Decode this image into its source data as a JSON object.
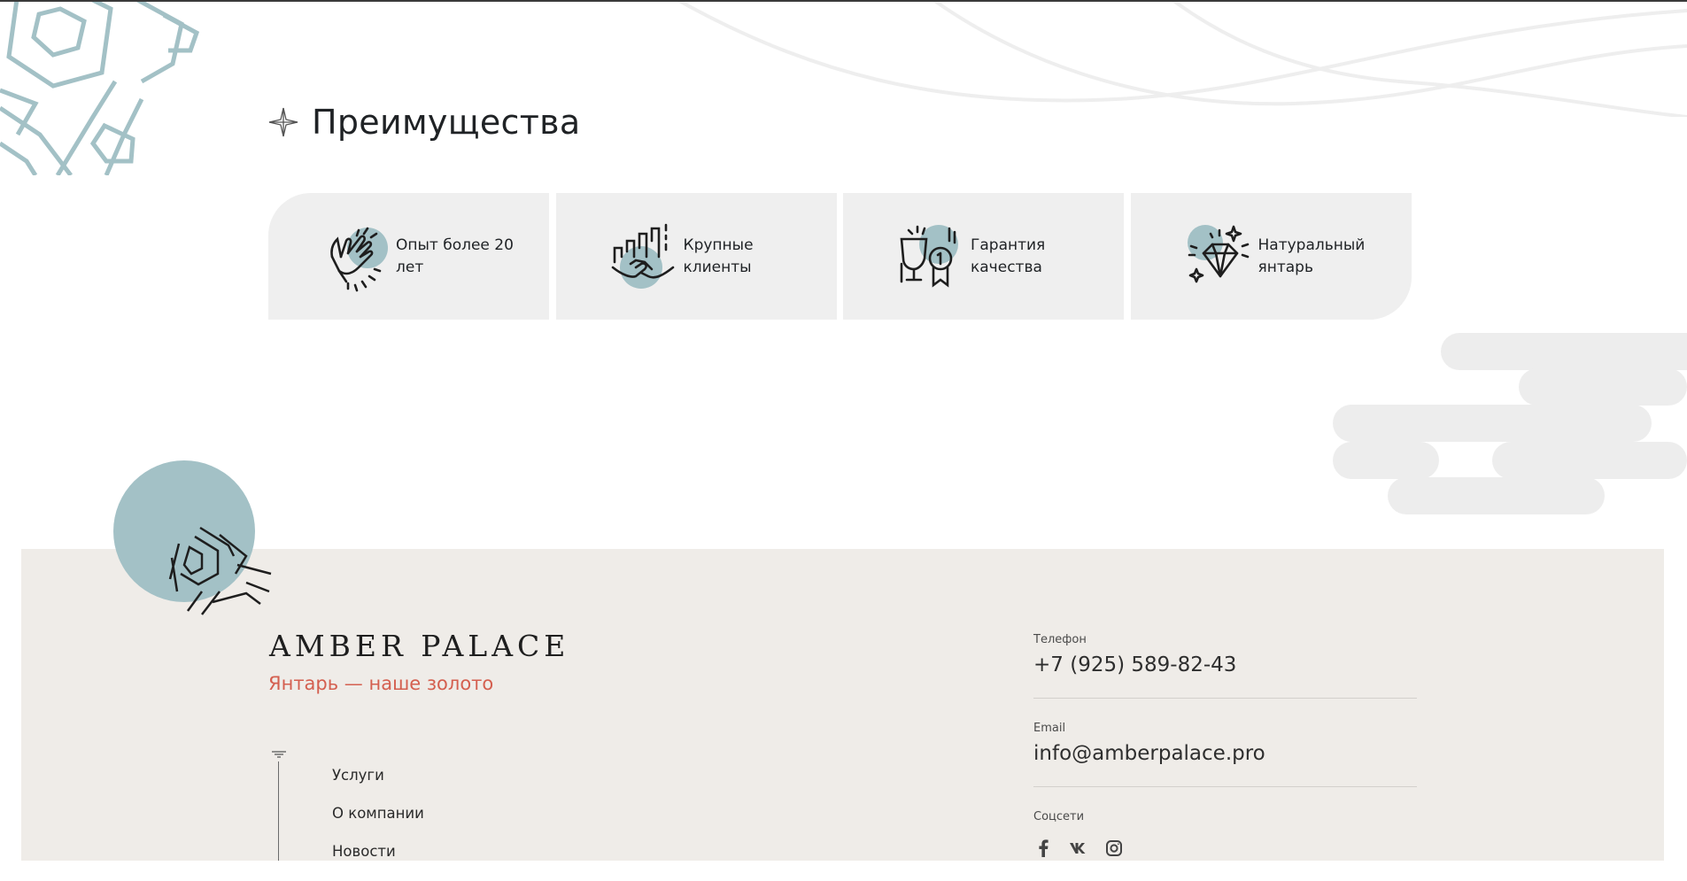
{
  "section": {
    "title": "Преимущества"
  },
  "advantages": [
    {
      "label": "Опыт более 20 лет",
      "icon": "clapping-hands-icon"
    },
    {
      "label": "Крупные клиенты",
      "icon": "handshake-icon"
    },
    {
      "label": "Гарантия качества",
      "icon": "trophy-medal-icon"
    },
    {
      "label": "Натуральный янтарь",
      "icon": "diamond-icon"
    }
  ],
  "footer": {
    "brand": "AMBER PALACE",
    "tagline": "Янтарь — наше золото",
    "nav": [
      "Услуги",
      "О компании",
      "Новости"
    ],
    "phone_label": "Телефон",
    "phone": "+7 (925) 589-82-43",
    "email_label": "Email",
    "email": "info@amberpalace.pro",
    "social_label": "Соцсети",
    "social": [
      "facebook-icon",
      "vk-icon",
      "instagram-icon"
    ]
  },
  "colors": {
    "accent_teal": "#a3c1c6",
    "tagline_red": "#d45f4f",
    "card_bg": "#efefef",
    "footer_bg": "#efece8"
  }
}
